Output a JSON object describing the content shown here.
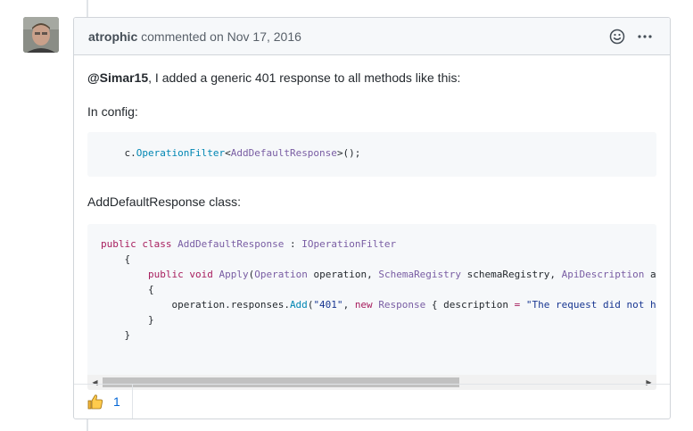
{
  "comment": {
    "author": "atrophic",
    "action_text": " commented on ",
    "date": "Nov 17, 2016",
    "mention": "@Simar15",
    "intro_text": ", I added a generic 401 response to all methods like this:",
    "config_label": "In config:",
    "class_label": "AddDefaultResponse class:",
    "reaction_emoji": "thumbs-up",
    "reaction_count": "1",
    "icons": [
      "smiley-icon",
      "kebab-icon",
      "scroll-left-icon",
      "scroll-right-icon"
    ]
  },
  "code1": {
    "obj": "c.",
    "method": "OperationFilter",
    "open": "<",
    "type": "AddDefaultResponse",
    "close": ">();"
  },
  "code2": {
    "l1_kw1": "public",
    "l1_kw2": "class",
    "l1_name": "AddDefaultResponse",
    "l1_colon": " : ",
    "l1_iface": "IOperationFilter",
    "brace_open": "{",
    "brace_close": "}",
    "l3_kw1": "public",
    "l3_kw2": "void",
    "l3_method": "Apply",
    "l3_paren": "(",
    "l3_t1": "Operation",
    "l3_a1": " operation, ",
    "l3_t2": "SchemaRegistry",
    "l3_a2": " schemaRegistry, ",
    "l3_t3": "ApiDescription",
    "l3_a3": " api",
    "l5_pre": "operation.responses.",
    "l5_method": "Add",
    "l5_paren": "(",
    "l5_str1": "\"401\"",
    "l5_comma": ", ",
    "l5_new": "new",
    "l5_type": "Response",
    "l5_rest": " { description ",
    "l5_eq": "=",
    "l5_str2": " \"The request did not hav"
  },
  "colors": {
    "keyword": "#a71d5d",
    "type": "#795da3",
    "string": "#183691",
    "link": "#0366d6"
  }
}
